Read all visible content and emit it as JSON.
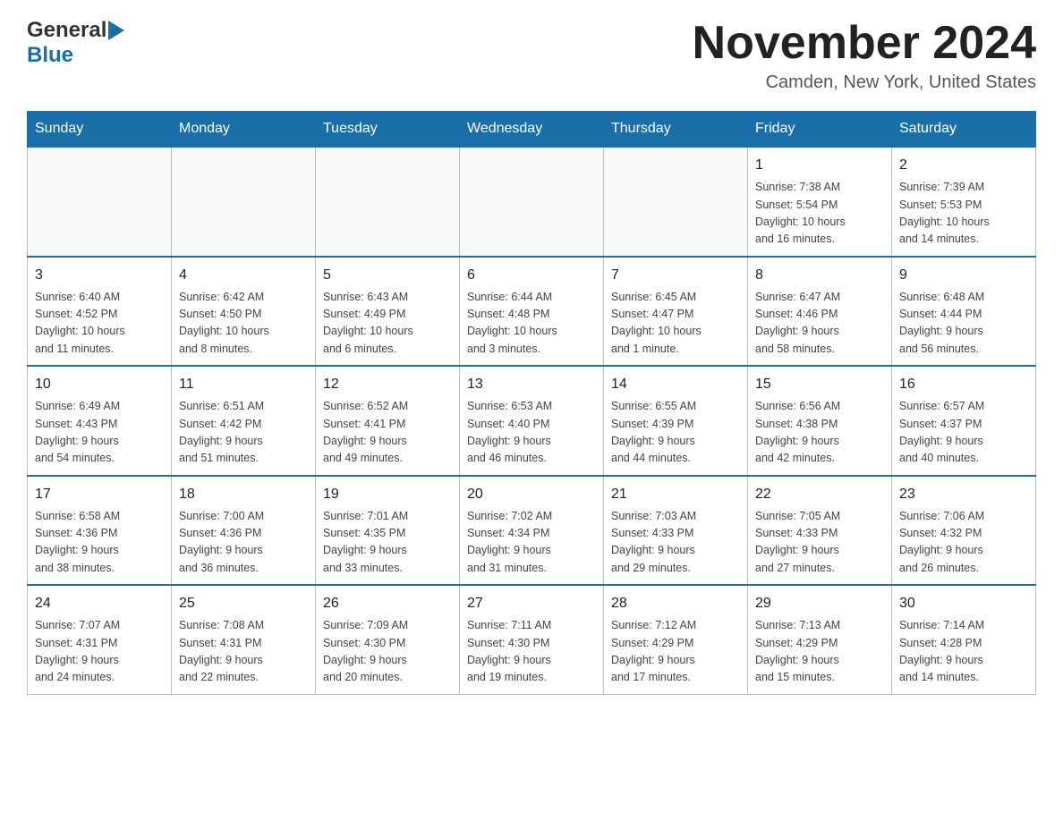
{
  "header": {
    "logo_general": "General",
    "logo_blue": "Blue",
    "month_title": "November 2024",
    "location": "Camden, New York, United States"
  },
  "days_of_week": [
    "Sunday",
    "Monday",
    "Tuesday",
    "Wednesday",
    "Thursday",
    "Friday",
    "Saturday"
  ],
  "weeks": [
    [
      {
        "day": "",
        "info": ""
      },
      {
        "day": "",
        "info": ""
      },
      {
        "day": "",
        "info": ""
      },
      {
        "day": "",
        "info": ""
      },
      {
        "day": "",
        "info": ""
      },
      {
        "day": "1",
        "info": "Sunrise: 7:38 AM\nSunset: 5:54 PM\nDaylight: 10 hours\nand 16 minutes."
      },
      {
        "day": "2",
        "info": "Sunrise: 7:39 AM\nSunset: 5:53 PM\nDaylight: 10 hours\nand 14 minutes."
      }
    ],
    [
      {
        "day": "3",
        "info": "Sunrise: 6:40 AM\nSunset: 4:52 PM\nDaylight: 10 hours\nand 11 minutes."
      },
      {
        "day": "4",
        "info": "Sunrise: 6:42 AM\nSunset: 4:50 PM\nDaylight: 10 hours\nand 8 minutes."
      },
      {
        "day": "5",
        "info": "Sunrise: 6:43 AM\nSunset: 4:49 PM\nDaylight: 10 hours\nand 6 minutes."
      },
      {
        "day": "6",
        "info": "Sunrise: 6:44 AM\nSunset: 4:48 PM\nDaylight: 10 hours\nand 3 minutes."
      },
      {
        "day": "7",
        "info": "Sunrise: 6:45 AM\nSunset: 4:47 PM\nDaylight: 10 hours\nand 1 minute."
      },
      {
        "day": "8",
        "info": "Sunrise: 6:47 AM\nSunset: 4:46 PM\nDaylight: 9 hours\nand 58 minutes."
      },
      {
        "day": "9",
        "info": "Sunrise: 6:48 AM\nSunset: 4:44 PM\nDaylight: 9 hours\nand 56 minutes."
      }
    ],
    [
      {
        "day": "10",
        "info": "Sunrise: 6:49 AM\nSunset: 4:43 PM\nDaylight: 9 hours\nand 54 minutes."
      },
      {
        "day": "11",
        "info": "Sunrise: 6:51 AM\nSunset: 4:42 PM\nDaylight: 9 hours\nand 51 minutes."
      },
      {
        "day": "12",
        "info": "Sunrise: 6:52 AM\nSunset: 4:41 PM\nDaylight: 9 hours\nand 49 minutes."
      },
      {
        "day": "13",
        "info": "Sunrise: 6:53 AM\nSunset: 4:40 PM\nDaylight: 9 hours\nand 46 minutes."
      },
      {
        "day": "14",
        "info": "Sunrise: 6:55 AM\nSunset: 4:39 PM\nDaylight: 9 hours\nand 44 minutes."
      },
      {
        "day": "15",
        "info": "Sunrise: 6:56 AM\nSunset: 4:38 PM\nDaylight: 9 hours\nand 42 minutes."
      },
      {
        "day": "16",
        "info": "Sunrise: 6:57 AM\nSunset: 4:37 PM\nDaylight: 9 hours\nand 40 minutes."
      }
    ],
    [
      {
        "day": "17",
        "info": "Sunrise: 6:58 AM\nSunset: 4:36 PM\nDaylight: 9 hours\nand 38 minutes."
      },
      {
        "day": "18",
        "info": "Sunrise: 7:00 AM\nSunset: 4:36 PM\nDaylight: 9 hours\nand 36 minutes."
      },
      {
        "day": "19",
        "info": "Sunrise: 7:01 AM\nSunset: 4:35 PM\nDaylight: 9 hours\nand 33 minutes."
      },
      {
        "day": "20",
        "info": "Sunrise: 7:02 AM\nSunset: 4:34 PM\nDaylight: 9 hours\nand 31 minutes."
      },
      {
        "day": "21",
        "info": "Sunrise: 7:03 AM\nSunset: 4:33 PM\nDaylight: 9 hours\nand 29 minutes."
      },
      {
        "day": "22",
        "info": "Sunrise: 7:05 AM\nSunset: 4:33 PM\nDaylight: 9 hours\nand 27 minutes."
      },
      {
        "day": "23",
        "info": "Sunrise: 7:06 AM\nSunset: 4:32 PM\nDaylight: 9 hours\nand 26 minutes."
      }
    ],
    [
      {
        "day": "24",
        "info": "Sunrise: 7:07 AM\nSunset: 4:31 PM\nDaylight: 9 hours\nand 24 minutes."
      },
      {
        "day": "25",
        "info": "Sunrise: 7:08 AM\nSunset: 4:31 PM\nDaylight: 9 hours\nand 22 minutes."
      },
      {
        "day": "26",
        "info": "Sunrise: 7:09 AM\nSunset: 4:30 PM\nDaylight: 9 hours\nand 20 minutes."
      },
      {
        "day": "27",
        "info": "Sunrise: 7:11 AM\nSunset: 4:30 PM\nDaylight: 9 hours\nand 19 minutes."
      },
      {
        "day": "28",
        "info": "Sunrise: 7:12 AM\nSunset: 4:29 PM\nDaylight: 9 hours\nand 17 minutes."
      },
      {
        "day": "29",
        "info": "Sunrise: 7:13 AM\nSunset: 4:29 PM\nDaylight: 9 hours\nand 15 minutes."
      },
      {
        "day": "30",
        "info": "Sunrise: 7:14 AM\nSunset: 4:28 PM\nDaylight: 9 hours\nand 14 minutes."
      }
    ]
  ]
}
